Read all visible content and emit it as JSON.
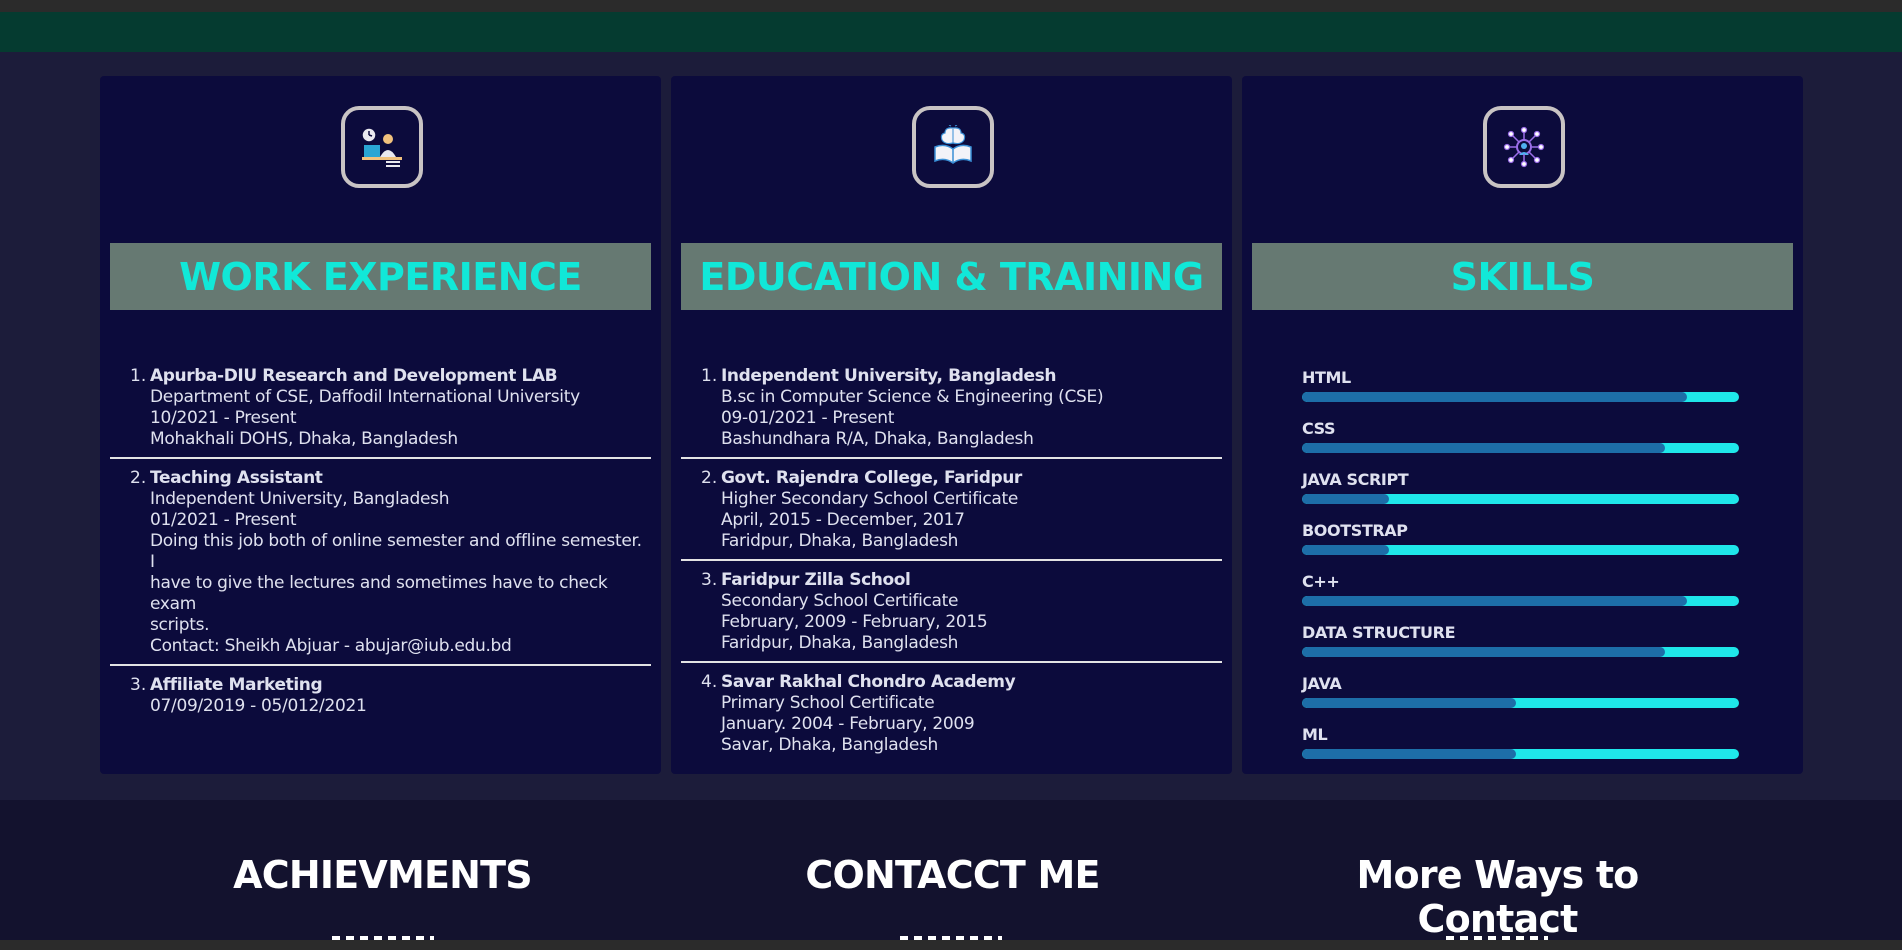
{
  "cards": {
    "work": {
      "icon": "office-worker-icon",
      "title": "WORK EXPERIENCE",
      "entries": [
        {
          "num": "1.",
          "name": "Apurba-DIU Research and Development LAB",
          "lines": [
            "Department of CSE, Daffodil International University",
            "10/2021 - Present",
            "Mohakhali DOHS, Dhaka, Bangladesh"
          ]
        },
        {
          "num": "2.",
          "name": "Teaching Assistant",
          "lines": [
            "Independent University, Bangladesh",
            "01/2021 - Present",
            "Doing this job both of online semester and offline semester. I",
            "have to give the lectures and sometimes have to check exam",
            "scripts.",
            "Contact: Sheikh Abjuar - abujar@iub.edu.bd"
          ]
        },
        {
          "num": "3.",
          "name": "Affiliate Marketing",
          "lines": [
            "07/09/2019 - 05/012/2021"
          ]
        }
      ]
    },
    "education": {
      "icon": "open-book-brain-icon",
      "title": "EDUCATION & TRAINING",
      "entries": [
        {
          "num": "1.",
          "name": "Independent University, Bangladesh",
          "lines": [
            "B.sc in Computer Science & Engineering (CSE)",
            "09-01/2021 - Present",
            "Bashundhara R/A, Dhaka, Bangladesh"
          ]
        },
        {
          "num": "2.",
          "name": "Govt. Rajendra College, Faridpur",
          "lines": [
            "Higher Secondary School Certificate",
            "April, 2015 - December, 2017",
            "Faridpur, Dhaka, Bangladesh"
          ]
        },
        {
          "num": "3.",
          "name": "Faridpur Zilla School",
          "lines": [
            "Secondary School Certificate",
            "February, 2009 - February, 2015",
            "Faridpur, Dhaka, Bangladesh"
          ]
        },
        {
          "num": "4.",
          "name": "Savar Rakhal Chondro Academy",
          "lines": [
            "Primary School Certificate",
            "January. 2004 - February, 2009",
            "Savar, Dhaka, Bangladesh"
          ]
        }
      ]
    },
    "skills": {
      "icon": "skills-network-icon",
      "title": "SKILLS",
      "items": [
        {
          "label": "HTML",
          "level": 0.88
        },
        {
          "label": "CSS",
          "level": 0.83
        },
        {
          "label": "JAVA SCRIPT",
          "level": 0.2
        },
        {
          "label": "BOOTSTRAP",
          "level": 0.2
        },
        {
          "label": "C++",
          "level": 0.88
        },
        {
          "label": "DATA STRUCTURE",
          "level": 0.83
        },
        {
          "label": "JAVA",
          "level": 0.49
        },
        {
          "label": "ML",
          "level": 0.49
        }
      ]
    }
  },
  "bottom": {
    "achievements": "ACHIEVMENTS",
    "contact": "CONTACCT ME",
    "more": "More Ways to Contact"
  },
  "colors": {
    "accent_title": "#11e8d8",
    "title_bar": "#667972",
    "card_bg": "#0c0b3c",
    "skill_fill": "#1d6ea8",
    "skill_track": "#1fe7ea"
  }
}
